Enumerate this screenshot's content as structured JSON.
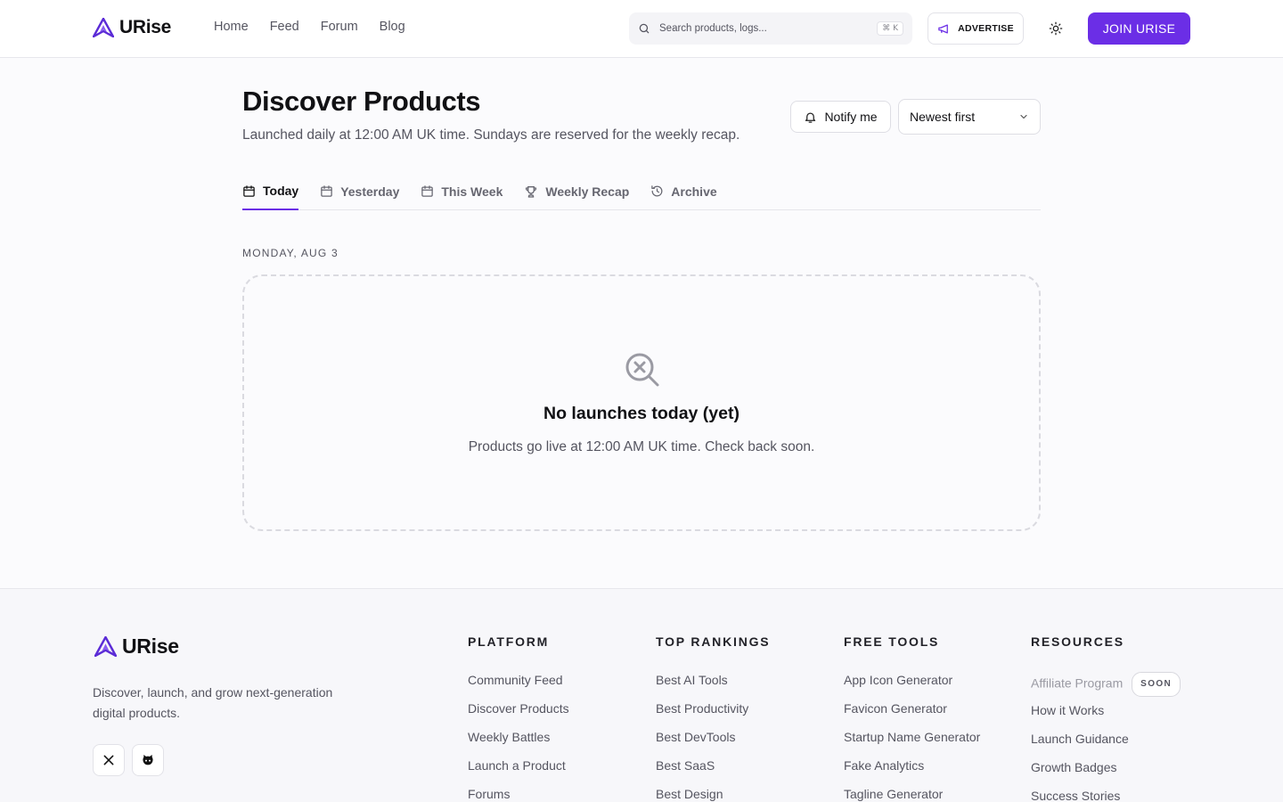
{
  "header": {
    "brand": "URise",
    "nav": [
      {
        "label": "Home"
      },
      {
        "label": "Feed"
      },
      {
        "label": "Forum"
      },
      {
        "label": "Blog"
      }
    ],
    "search": {
      "placeholder": "Search products, logs...",
      "shortcut": "⌘ K"
    },
    "advertise_label": "ADVERTISE",
    "join_label": "JOIN URISE"
  },
  "main": {
    "title": "Discover Products",
    "subtitle": "Launched daily at 12:00 AM UK time. Sundays are reserved for the weekly recap.",
    "notify_label": "Notify me",
    "sort_value": "Newest first",
    "tabs": [
      {
        "label": "Today",
        "icon": "calendar-icon",
        "active": true
      },
      {
        "label": "Yesterday",
        "icon": "calendar-icon"
      },
      {
        "label": "This Week",
        "icon": "calendar-icon"
      },
      {
        "label": "Weekly Recap",
        "icon": "trophy-icon"
      },
      {
        "label": "Archive",
        "icon": "history-icon"
      }
    ],
    "date_label": "MONDAY, AUG 3",
    "empty": {
      "icon": "search-x-icon",
      "title": "No launches today (yet)",
      "text": "Products go live at 12:00 AM UK time. Check back soon."
    }
  },
  "footer": {
    "brand": "URise",
    "tagline": "Discover, launch, and grow next-generation digital products.",
    "social": [
      {
        "icon": "x-logo-icon"
      },
      {
        "icon": "github-icon"
      }
    ],
    "columns": [
      {
        "title": "PLATFORM",
        "links": [
          "Community Feed",
          "Discover Products",
          "Weekly Battles",
          "Launch a Product",
          "Forums"
        ]
      },
      {
        "title": "TOP RANKINGS",
        "links": [
          "Best AI Tools",
          "Best Productivity",
          "Best DevTools",
          "Best SaaS",
          "Best Design"
        ]
      },
      {
        "title": "FREE TOOLS",
        "links": [
          "App Icon Generator",
          "Favicon Generator",
          "Startup Name Generator",
          "Fake Analytics",
          "Tagline Generator"
        ]
      },
      {
        "title": "RESOURCES",
        "links": [
          "Affiliate Program",
          "How it Works",
          "Launch Guidance",
          "Growth Badges",
          "Success Stories"
        ],
        "badge": "SOON"
      }
    ]
  },
  "colors": {
    "accent": "#6b2ee6",
    "text": "#111114",
    "muted": "#555560",
    "border": "#e7e7ec"
  }
}
